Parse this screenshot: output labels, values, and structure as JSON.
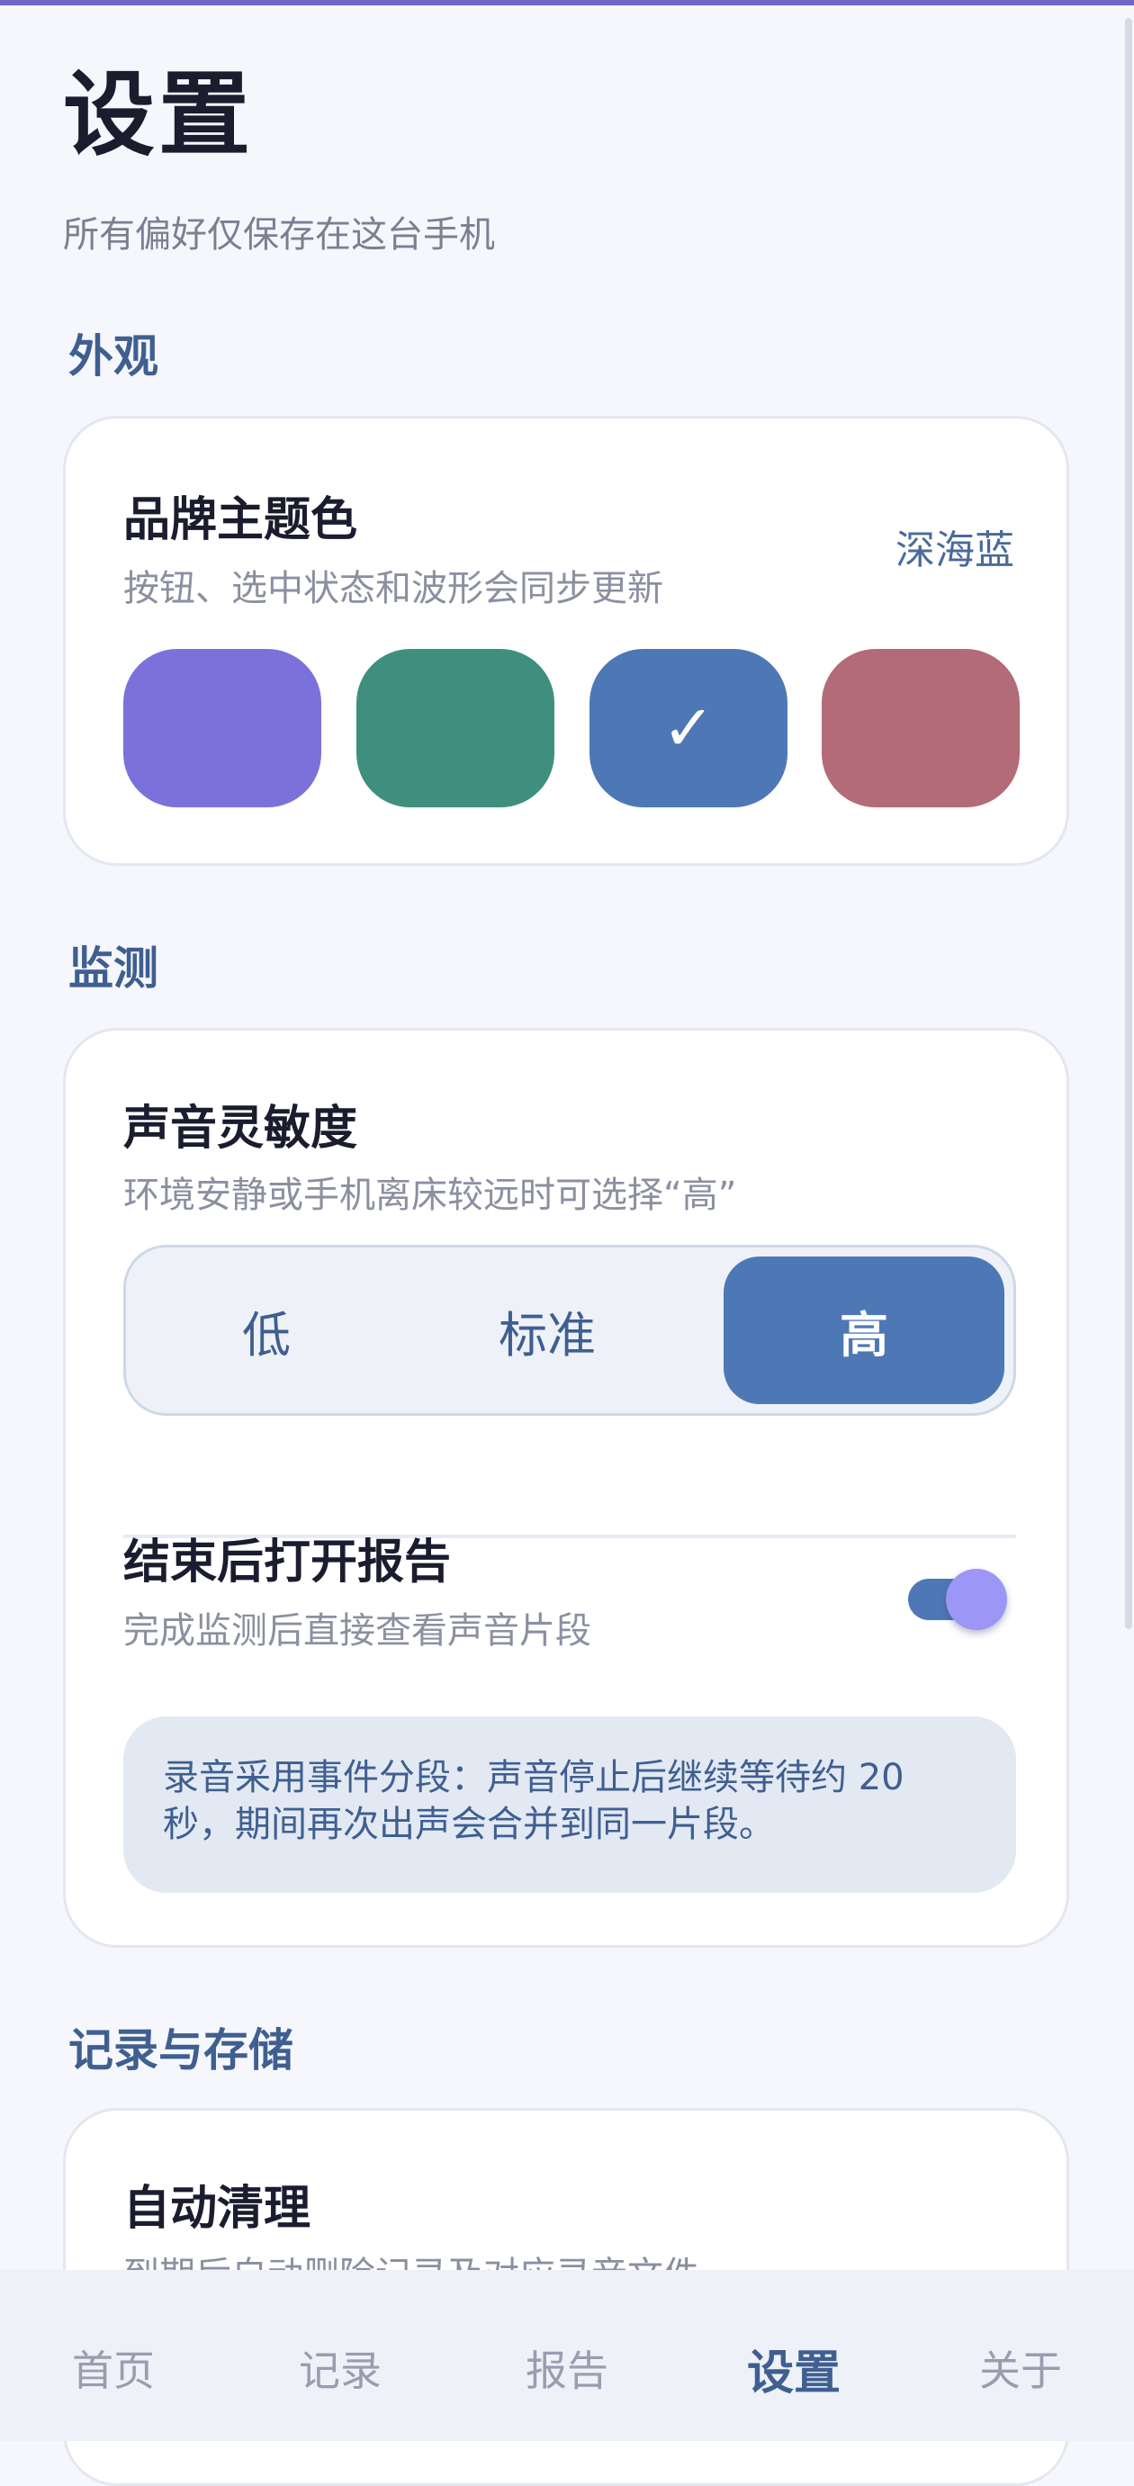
{
  "header": {
    "title": "设置",
    "subtitle": "所有偏好仅保存在这台手机"
  },
  "sections": {
    "appearance": "外观",
    "monitoring": "监测",
    "storage": "记录与存储"
  },
  "theme": {
    "title": "品牌主题色",
    "description": "按钮、选中状态和波形会同步更新",
    "current_value": "深海蓝",
    "selected_index": 2,
    "check_glyph": "✓",
    "swatch_colors": [
      "#7a72da",
      "#3f8f7f",
      "#4e78b5",
      "#b36b78"
    ]
  },
  "sensitivity": {
    "title": "声音灵敏度",
    "description": "环境安静或手机离床较远时可选择“高”",
    "options": [
      "低",
      "标准",
      "高"
    ],
    "selected": "高"
  },
  "open_report": {
    "title": "结束后打开报告",
    "description": "完成监测后直接查看声音片段",
    "enabled": true
  },
  "note": "录音采用事件分段：声音停止后继续等待约 20 秒，期间再次出声会合并到同一片段。",
  "auto_clean": {
    "title": "自动清理",
    "description": "到期后自动删除记录及对应录音文件"
  },
  "nav": {
    "items": [
      "首页",
      "记录",
      "报告",
      "设置",
      "关于"
    ],
    "active": "设置"
  },
  "colors": {
    "accent": "#4e78b5",
    "heading": "#3f5f91",
    "toggle_thumb": "#9c96f6",
    "top_bar": "#6f67c7"
  }
}
